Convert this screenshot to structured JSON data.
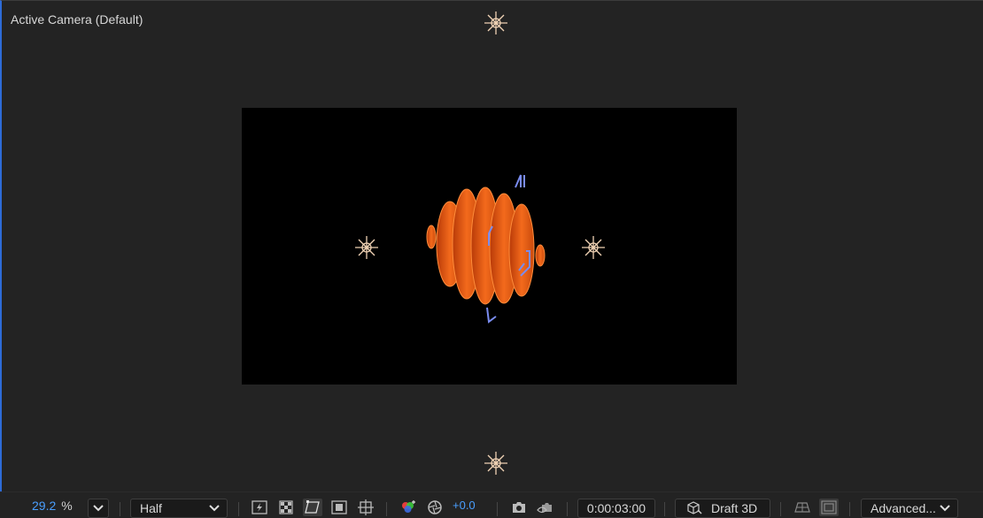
{
  "viewer": {
    "camera_label": "Active Camera (Default)"
  },
  "toolbar": {
    "zoom_value": "29.2",
    "zoom_unit": "%",
    "resolution": "Half",
    "exposure": "+0.0",
    "timecode": "0:00:03:00",
    "renderer": "Draft 3D",
    "view_menu": "Advanced..."
  },
  "icons": {
    "zoom_dropdown": "chevron-down-icon",
    "fast_preview": "fast-preview-icon",
    "transparency": "transparency-grid-icon",
    "mask_path": "mask-path-visibility-icon",
    "region": "region-of-interest-icon",
    "guides": "grid-guides-icon",
    "channels": "color-channels-icon",
    "reset_exposure": "reset-exposure-icon",
    "snapshot": "camera-snapshot-icon",
    "show_snapshot": "show-snapshot-icon",
    "renderer": "3d-renderer-icon",
    "ground_plane": "ground-plane-icon",
    "extended_viewer": "extended-viewer-icon"
  },
  "colors": {
    "accent_blue": "#4a9fff",
    "panel_bg": "#232323",
    "comp_bg": "#000000",
    "object_orange": "#e85a14",
    "light_icon": "#f0d2b4"
  }
}
